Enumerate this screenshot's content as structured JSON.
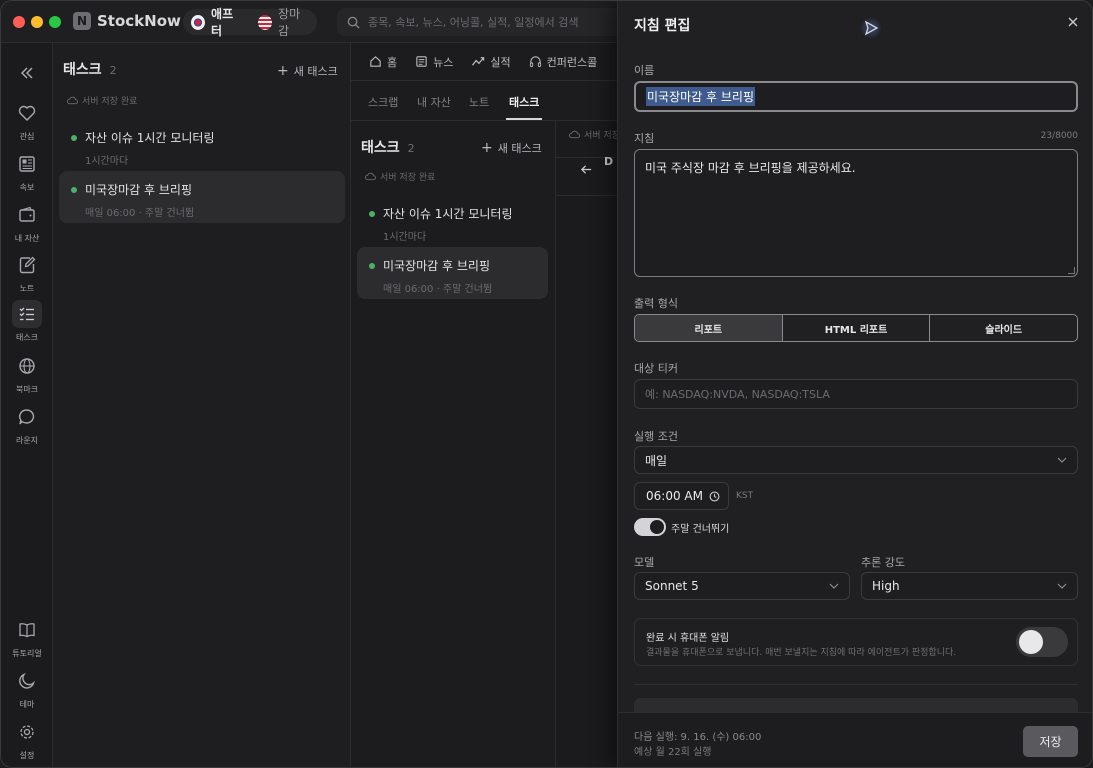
{
  "topbar": {
    "brand": "StockNow",
    "session_kr": "애프터",
    "session_us": "장마감",
    "search_placeholder": "종목, 속보, 뉴스, 어닝콜, 실적, 일정에서 검색"
  },
  "rail": {
    "items": [
      {
        "label": "관심",
        "icon": "heart-icon"
      },
      {
        "label": "속보",
        "icon": "newspaper-icon"
      },
      {
        "label": "내 자산",
        "icon": "wallet-icon"
      },
      {
        "label": "노트",
        "icon": "note-icon"
      },
      {
        "label": "태스크",
        "icon": "checklist-icon",
        "active": true
      },
      {
        "label": "북마크",
        "icon": "globe-icon"
      },
      {
        "label": "라운지",
        "icon": "chat-icon"
      }
    ],
    "bottom": [
      {
        "label": "튜토리얼",
        "icon": "book-icon"
      },
      {
        "label": "테마",
        "icon": "moon-icon"
      },
      {
        "label": "설정",
        "icon": "gear-icon"
      }
    ]
  },
  "tasks_panel": {
    "title": "태스크",
    "count": "2",
    "new_task": "새 태스크",
    "saved": "서버 저장 완료",
    "items": [
      {
        "title": "자산 이슈 1시간 모니터링",
        "sub": "1시간마다"
      },
      {
        "title": "미국장마감 후 브리핑",
        "sub": "매일 06:00 · 주말 건너뜀"
      }
    ]
  },
  "nav": {
    "tabs": [
      "홈",
      "뉴스",
      "실적",
      "컨퍼런스콜"
    ],
    "subtabs": [
      "스크랩",
      "내 자산",
      "노트",
      "태스크"
    ],
    "active_subtab": "태스크",
    "peek_saved": "서버 저장",
    "peek_letter": "D"
  },
  "drawer": {
    "title": "지침 편집",
    "name_label": "이름",
    "name_value": "미국장마감 후 브리핑",
    "instr_label": "지침",
    "instr_count": "23/8000",
    "instr_value": "미국 주식장 마감 후 브리핑을 제공하세요.",
    "format_label": "출력 형식",
    "formats": [
      "리포트",
      "HTML 리포트",
      "슬라이드"
    ],
    "format_selected": "리포트",
    "ticker_label": "대상 티커",
    "ticker_placeholder": "예: NASDAQ:NVDA, NASDAQ:TSLA",
    "cond_label": "실행 조건",
    "cond_value": "매일",
    "time_value": "06:00 AM",
    "tz": "KST",
    "skip_weekend": "주말 건너뛰기",
    "skip_weekend_on": true,
    "model_label": "모델",
    "model_value": "Sonnet 5",
    "effort_label": "추론 강도",
    "effort_value": "High",
    "notify_title": "완료 시 휴대폰 알림",
    "notify_desc": "결과물을 휴대폰으로 보냅니다. 매번 보낼지는 지침에 따라 에이전트가 판정합니다.",
    "notify_on": false,
    "next_run": "다음 실행: 9. 16. (수) 06:00",
    "estimate": "예상 월 22회 실행",
    "save": "저장"
  },
  "colors": {
    "background": "#1c1c1e",
    "drawer": "#202022",
    "status_dot": "#4caf6a",
    "selection": "#3f5a8c",
    "save_button": "#5a5a5e"
  }
}
